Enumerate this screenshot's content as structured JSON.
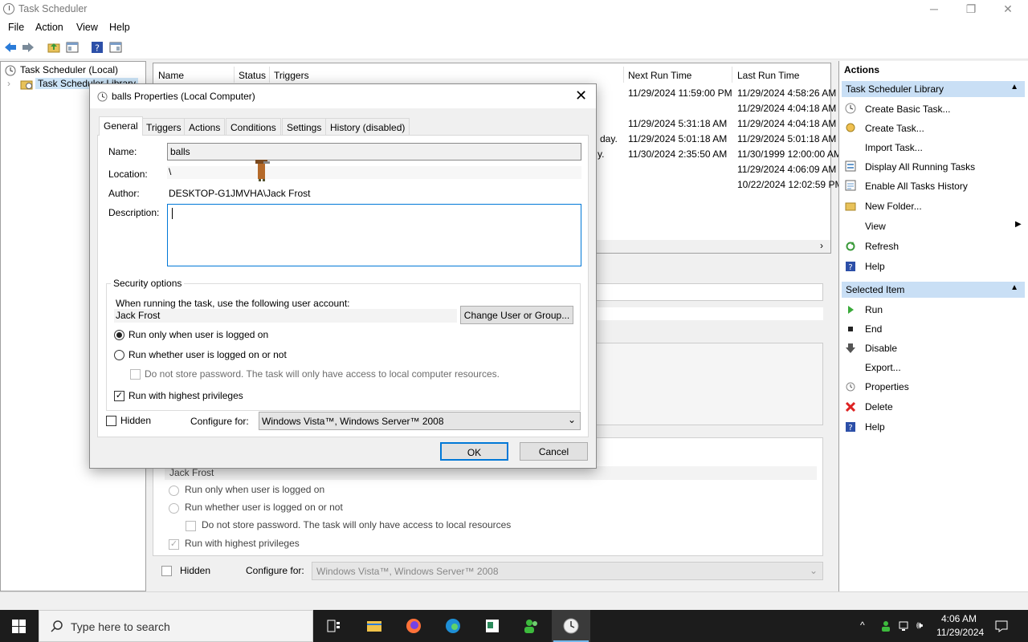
{
  "window": {
    "title": "Task Scheduler"
  },
  "menu": [
    "File",
    "Action",
    "View",
    "Help"
  ],
  "tree": {
    "root": "Task Scheduler (Local)",
    "child": "Task Scheduler Library"
  },
  "tasklist": {
    "headers": [
      "Name",
      "Status",
      "Triggers",
      "Next Run Time",
      "Last Run Time"
    ],
    "rows": [
      {
        "trig": "",
        "next": "11/29/2024 11:59:00 PM",
        "last": "11/29/2024 4:58:26 AM"
      },
      {
        "trig": "",
        "next": "",
        "last": "11/29/2024 4:04:18 AM"
      },
      {
        "trig": "",
        "next": "11/29/2024 5:31:18 AM",
        "last": "11/29/2024 4:04:18 AM"
      },
      {
        "trig": "day.",
        "next": "11/29/2024 5:01:18 AM",
        "last": "11/29/2024 5:01:18 AM"
      },
      {
        "trig": "y.",
        "next": "11/30/2024 2:35:50 AM",
        "last": "11/30/1999 12:00:00 AM"
      },
      {
        "trig": "",
        "next": "",
        "last": "11/29/2024 4:06:09 AM"
      },
      {
        "trig": "",
        "next": "",
        "last": "10/22/2024 12:02:59 PM"
      }
    ]
  },
  "bgdetail": {
    "account": "Jack Frost",
    "radio1": "Run only when user is logged on",
    "radio2": "Run whether user is logged on or not",
    "nostore": "Do not store password.  The task will only have access to local resources",
    "highest": "Run with highest privileges",
    "hidden": "Hidden",
    "configure_label": "Configure for:",
    "configure_value": "Windows Vista™, Windows Server™ 2008"
  },
  "actions": {
    "section1": "Actions",
    "library_header": "Task Scheduler Library",
    "library_items": [
      "Create Basic Task...",
      "Create Task...",
      "Import Task...",
      "Display All Running Tasks",
      "Enable All Tasks History",
      "New Folder...",
      "View",
      "Refresh",
      "Help"
    ],
    "selected_header": "Selected Item",
    "selected_items": [
      "Run",
      "End",
      "Disable",
      "Export...",
      "Properties",
      "Delete",
      "Help"
    ]
  },
  "dialog": {
    "title": "balls Properties (Local Computer)",
    "tabs": [
      "General",
      "Triggers",
      "Actions",
      "Conditions",
      "Settings",
      "History (disabled)"
    ],
    "name_label": "Name:",
    "name_value": "balls",
    "location_label": "Location:",
    "location_value": "\\",
    "author_label": "Author:",
    "author_value": "DESKTOP-G1JMVHA\\Jack Frost",
    "description_label": "Description:",
    "description_value": "",
    "security_title": "Security options",
    "security_prompt": "When running the task, use the following user account:",
    "account": "Jack Frost",
    "change_user": "Change User or Group...",
    "radio_logged_on": "Run only when user is logged on",
    "radio_whether": "Run whether user is logged on or not",
    "no_store": "Do not store password.  The task will only have access to local computer resources.",
    "highest": "Run with highest privileges",
    "hidden": "Hidden",
    "configure_label": "Configure for:",
    "configure_value": "Windows Vista™, Windows Server™ 2008",
    "ok": "OK",
    "cancel": "Cancel"
  },
  "taskbar": {
    "search_placeholder": "Type here to search",
    "time": "4:06 AM",
    "date": "11/29/2024"
  }
}
